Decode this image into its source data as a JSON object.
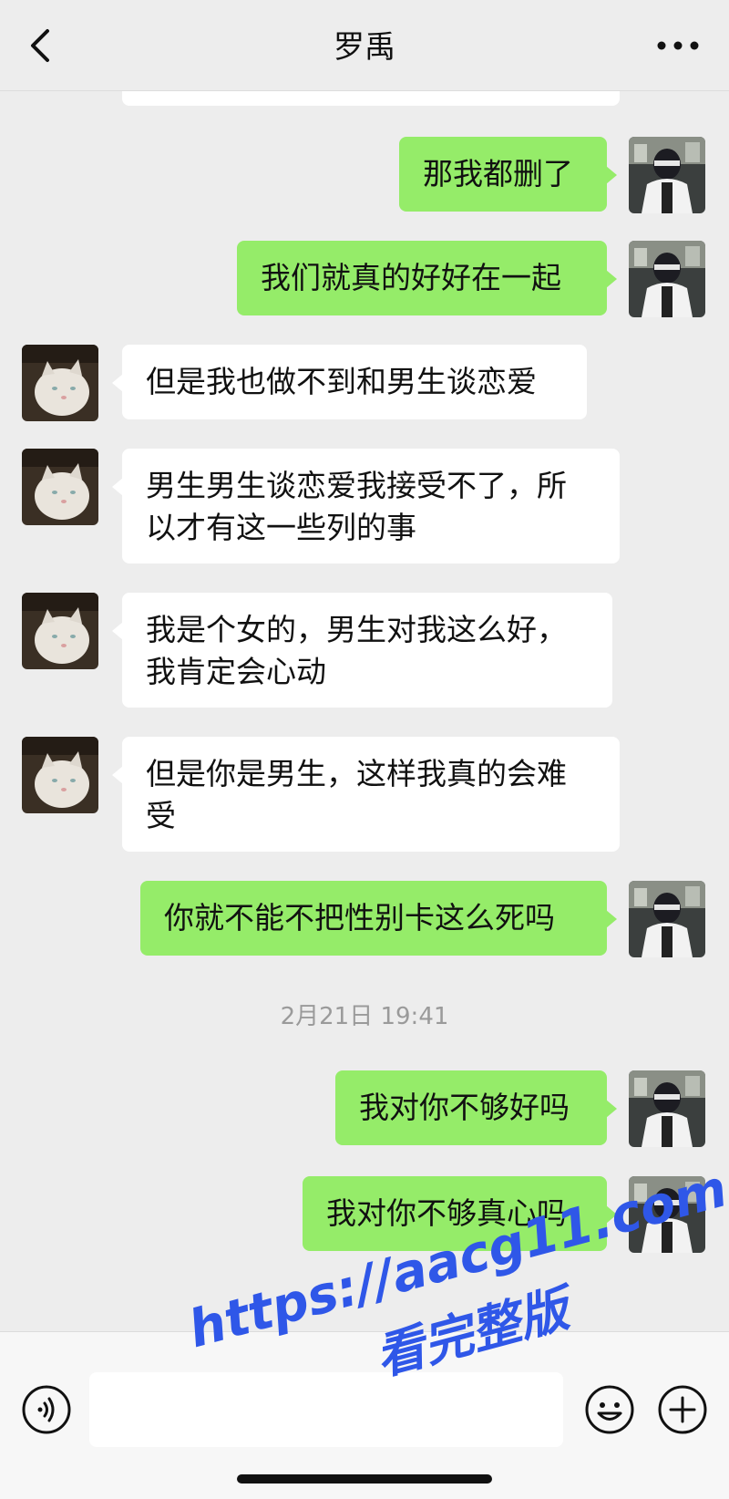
{
  "header": {
    "title": "罗禹"
  },
  "messages": [
    {
      "id": "m1",
      "text": "那我都删了"
    },
    {
      "id": "m2",
      "text": "我们就真的好好在一起"
    },
    {
      "id": "m3",
      "text": "但是我也做不到和男生谈恋爱"
    },
    {
      "id": "m4",
      "text": "男生男生谈恋爱我接受不了，所\n以才有这一些列的事"
    },
    {
      "id": "m5",
      "text": "我是个女的，男生对我这么好，\n我肯定会心动"
    },
    {
      "id": "m6",
      "text": "但是你是男生，这样我真的会难\n受"
    },
    {
      "id": "m7",
      "text": "你就不能不把性别卡这么死吗"
    },
    {
      "id": "m8",
      "text": "我对你不够好吗"
    },
    {
      "id": "m9",
      "text": "我对你不够真心吗"
    }
  ],
  "timestamp": "2月21日 19:41",
  "input": {
    "value": ""
  },
  "watermark": {
    "url": "https://aacg11.com",
    "subtitle": "看完整版"
  },
  "icons": {
    "back": "chevron-left-icon",
    "more": "more-dots-icon",
    "voice": "voice-icon",
    "emoji": "emoji-icon",
    "plus": "plus-icon"
  },
  "colors": {
    "background": "#ededed",
    "outgoing_bubble": "#95ec69",
    "incoming_bubble": "#ffffff",
    "watermark": "#2f57e8"
  }
}
